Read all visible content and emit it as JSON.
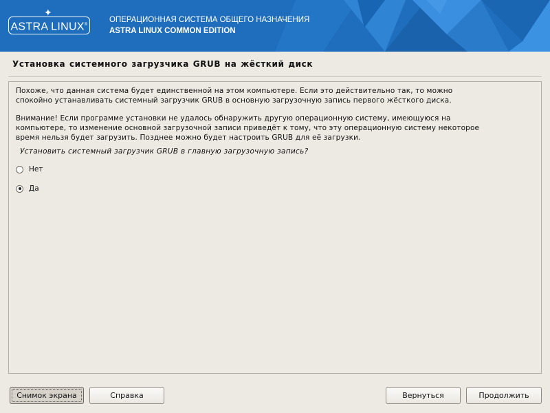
{
  "banner": {
    "logo_text": "ASTRA LINUX",
    "logo_mark": "®",
    "title": "ОПЕРАЦИОННАЯ СИСТЕМА ОБЩЕГО НАЗНАЧЕНИЯ",
    "subtitle": "ASTRA LINUX COMMON EDITION",
    "colors": {
      "background": "#1d6fc0",
      "accent": "#3a8fe0",
      "text": "#ffffff"
    }
  },
  "step": {
    "title": "Установка системного загрузчика GRUB на жёсткий диск"
  },
  "content": {
    "paragraph1": "Похоже, что данная система будет единственной на этом компьютере. Если это действительно так, то можно\nспокойно устанавливать системный загрузчик GRUB в основную загрузочную запись первого жёсткого диска.",
    "paragraph2": "Внимание! Если программе установки не удалось обнаружить другую операционную систему, имеющуюся на\nкомпьютере, то изменение основной загрузочной записи приведёт к тому, что эту операционную систему некоторое\nвремя нельзя будет загрузить. Позднее можно будет настроить GRUB для её загрузки.",
    "question": "Установить системный загрузчик GRUB в главную загрузочную запись?",
    "options": [
      {
        "label": "Нет",
        "selected": false
      },
      {
        "label": "Да",
        "selected": true
      }
    ]
  },
  "buttons": {
    "screenshot": "Снимок экрана",
    "help": "Справка",
    "back": "Вернуться",
    "continue": "Продолжить"
  }
}
